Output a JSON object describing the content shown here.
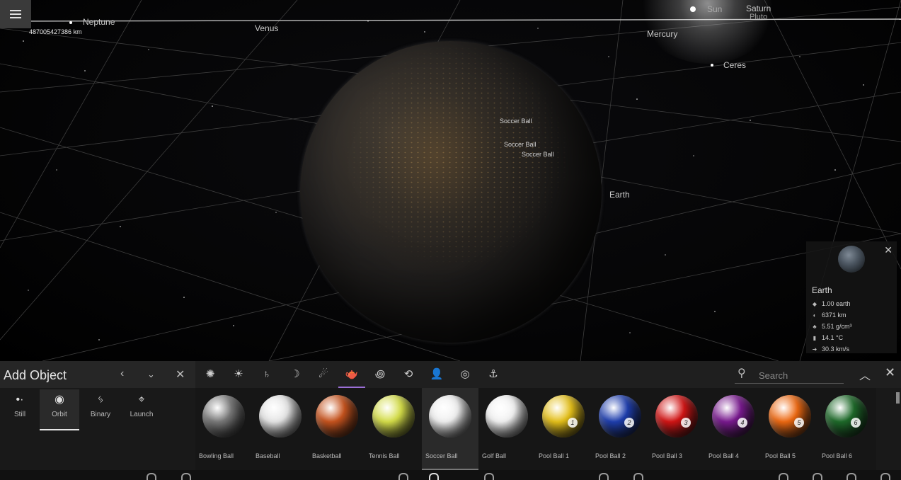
{
  "viewport": {
    "distance_readout": "487005427386 km",
    "planet_labels": {
      "neptune": "Neptune",
      "venus": "Venus",
      "sun": "Sun",
      "saturn": "Saturn",
      "pluto": "Pluto",
      "mercury": "Mercury",
      "ceres": "Ceres",
      "earth": "Earth"
    },
    "object_labels": [
      "Soccer Ball",
      "Soccer Ball",
      "Soccer Ball"
    ]
  },
  "info_card": {
    "name": "Earth",
    "stats": [
      {
        "icon": "mass-icon",
        "glyph": "◆",
        "value": "1.00 earth"
      },
      {
        "icon": "radius-icon",
        "glyph": "◐",
        "value": "6371 km"
      },
      {
        "icon": "density-icon",
        "glyph": "♣",
        "value": "5.51 g/cm³"
      },
      {
        "icon": "temperature-icon",
        "glyph": "🌡",
        "value": "14.1 °C"
      },
      {
        "icon": "speed-icon",
        "glyph": "➜",
        "value": "30.3 km/s"
      }
    ]
  },
  "panel": {
    "title": "Add Object",
    "modes": [
      {
        "id": "still",
        "label": "Still",
        "glyph": "•·"
      },
      {
        "id": "orbit",
        "label": "Orbit",
        "glyph": "◉"
      },
      {
        "id": "binary",
        "label": "Binary",
        "glyph": "ᛃ"
      },
      {
        "id": "launch",
        "label": "Launch",
        "glyph": "⌖"
      }
    ],
    "active_mode": "Orbit",
    "categories": [
      {
        "icon": "star-cluster-icon",
        "glyph": "✺"
      },
      {
        "icon": "sun-icon",
        "glyph": "☀"
      },
      {
        "icon": "planet-ring-icon",
        "glyph": "♄"
      },
      {
        "icon": "moon-icon",
        "glyph": "☽"
      },
      {
        "icon": "comet-icon",
        "glyph": "☄"
      },
      {
        "icon": "teapot-icon",
        "glyph": "🫖"
      },
      {
        "icon": "galaxy-icon",
        "glyph": "꩜"
      },
      {
        "icon": "orbit-ring-icon",
        "glyph": "⟲"
      },
      {
        "icon": "person-icon",
        "glyph": "👤"
      },
      {
        "icon": "target-icon",
        "glyph": "◎"
      },
      {
        "icon": "anchor-icon",
        "glyph": "⚓"
      }
    ],
    "search_placeholder": "Search",
    "items": [
      {
        "label": "Bowling Ball",
        "color": "#7a7a7a",
        "number": ""
      },
      {
        "label": "Baseball",
        "color": "#e8e8e8",
        "number": ""
      },
      {
        "label": "Basketball",
        "color": "#c8541e",
        "number": ""
      },
      {
        "label": "Tennis Ball",
        "color": "#d7e04a",
        "number": ""
      },
      {
        "label": "Soccer Ball",
        "color": "#f2f2f2",
        "number": ""
      },
      {
        "label": "Golf Ball",
        "color": "#f4f4f4",
        "number": ""
      },
      {
        "label": "Pool Ball 1",
        "color": "#e7c21a",
        "number": "1"
      },
      {
        "label": "Pool Ball 2",
        "color": "#1f3fb0",
        "number": "2"
      },
      {
        "label": "Pool Ball 3",
        "color": "#d41515",
        "number": "3"
      },
      {
        "label": "Pool Ball 4",
        "color": "#7a1a90",
        "number": "4"
      },
      {
        "label": "Pool Ball 5",
        "color": "#f06a12",
        "number": "5"
      },
      {
        "label": "Pool Ball 6",
        "color": "#1e6b2a",
        "number": "6"
      }
    ],
    "active_item": "Soccer Ball"
  }
}
